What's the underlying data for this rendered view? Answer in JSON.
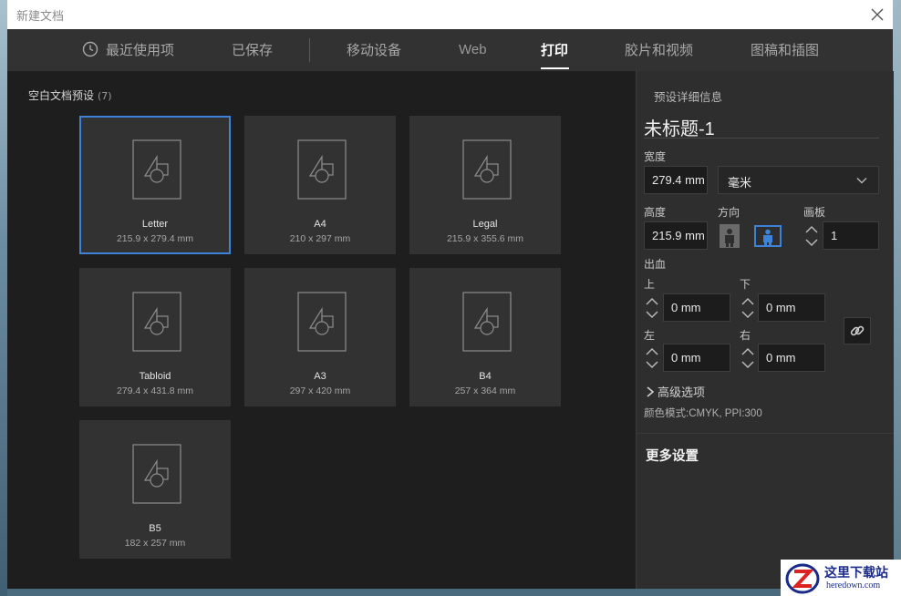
{
  "window": {
    "title": "新建文档"
  },
  "tabs": [
    {
      "label": "最近使用项",
      "icon": "clock-icon"
    },
    {
      "label": "已保存"
    },
    {
      "label": "移动设备"
    },
    {
      "label": "Web"
    },
    {
      "label": "打印",
      "active": true
    },
    {
      "label": "胶片和视频"
    },
    {
      "label": "图稿和插图"
    }
  ],
  "presets": {
    "label": "空白文档预设",
    "count": "(7)",
    "items": [
      {
        "name": "Letter",
        "dims": "215.9 x 279.4 mm",
        "selected": true
      },
      {
        "name": "A4",
        "dims": "210 x 297 mm"
      },
      {
        "name": "Legal",
        "dims": "215.9 x 355.6 mm"
      },
      {
        "name": "Tabloid",
        "dims": "279.4 x 431.8 mm"
      },
      {
        "name": "A3",
        "dims": "297 x 420 mm"
      },
      {
        "name": "B4",
        "dims": "257 x 364 mm"
      },
      {
        "name": "B5",
        "dims": "182 x 257 mm"
      }
    ]
  },
  "details": {
    "heading": "预设详细信息",
    "doc_name": "未标题-1",
    "width_label": "宽度",
    "width_value": "279.4 mm",
    "unit": "毫米",
    "height_label": "高度",
    "height_value": "215.9 mm",
    "orientation_label": "方向",
    "orientation": "landscape",
    "artboard_label": "画板",
    "artboard_value": "1",
    "bleed_label": "出血",
    "bleed": {
      "top_label": "上",
      "top": "0 mm",
      "bottom_label": "下",
      "bottom": "0 mm",
      "left_label": "左",
      "left": "0 mm",
      "right_label": "右",
      "right": "0 mm"
    },
    "advanced_label": "高级选项",
    "color_mode": "颜色模式:CMYK, PPI:300",
    "more_settings": "更多设置"
  },
  "watermark": {
    "main": "这里下载站",
    "sub": "heredown.com"
  },
  "colors": {
    "accent": "#3b82d8",
    "dialog_bg": "#1e1e1e",
    "card_bg": "#323232",
    "panel_bg": "#2e2e2e"
  }
}
